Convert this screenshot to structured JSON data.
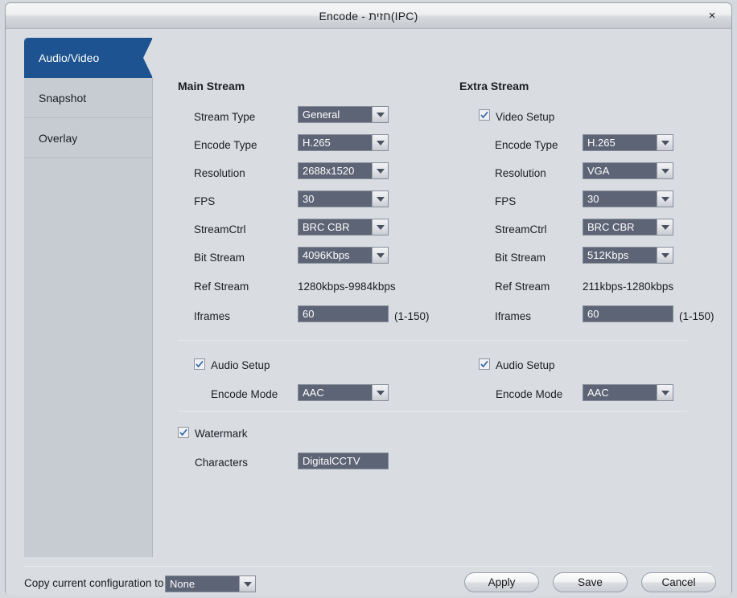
{
  "window": {
    "title": "Encode  - חזית(IPC)",
    "close_icon": "close-icon",
    "close_glyph": "×"
  },
  "sidebar": {
    "items": [
      {
        "label": "Audio/Video",
        "active": true
      },
      {
        "label": "Snapshot",
        "active": false
      },
      {
        "label": "Overlay",
        "active": false
      }
    ]
  },
  "main_stream": {
    "heading": "Main Stream",
    "fields": {
      "stream_type": {
        "label": "Stream Type",
        "value": "General"
      },
      "encode_type": {
        "label": "Encode Type",
        "value": "H.265"
      },
      "resolution": {
        "label": "Resolution",
        "value": "2688x1520"
      },
      "fps": {
        "label": "FPS",
        "value": "30"
      },
      "stream_ctrl": {
        "label": "StreamCtrl",
        "value": "BRC  CBR"
      },
      "bit_stream": {
        "label": "Bit Stream",
        "value": "4096Kbps"
      },
      "ref_stream": {
        "label": "Ref Stream",
        "value": "1280kbps-9984kbps"
      },
      "iframes": {
        "label": "Iframes",
        "value": "60",
        "hint": "(1-150)"
      }
    },
    "audio": {
      "setup_label": "Audio Setup",
      "setup_checked": true,
      "encode_mode_label": "Encode Mode",
      "encode_mode_value": "AAC"
    }
  },
  "extra_stream": {
    "heading": "Extra Stream",
    "video_setup": {
      "label": "Video Setup",
      "checked": true
    },
    "fields": {
      "encode_type": {
        "label": "Encode Type",
        "value": "H.265"
      },
      "resolution": {
        "label": "Resolution",
        "value": "VGA"
      },
      "fps": {
        "label": "FPS",
        "value": "30"
      },
      "stream_ctrl": {
        "label": "StreamCtrl",
        "value": "BRC  CBR"
      },
      "bit_stream": {
        "label": "Bit Stream",
        "value": "512Kbps"
      },
      "ref_stream": {
        "label": "Ref Stream",
        "value": "211kbps-1280kbps"
      },
      "iframes": {
        "label": "Iframes",
        "value": "60",
        "hint": "(1-150)"
      }
    },
    "audio": {
      "setup_label": "Audio Setup",
      "setup_checked": true,
      "encode_mode_label": "Encode Mode",
      "encode_mode_value": "AAC"
    }
  },
  "watermark": {
    "label": "Watermark",
    "checked": true,
    "characters_label": "Characters",
    "characters_value": "DigitalCCTV"
  },
  "footer": {
    "copy_label": "Copy current configuration to",
    "copy_value": "None",
    "apply_label": "Apply",
    "save_label": "Save",
    "cancel_label": "Cancel"
  },
  "colors": {
    "accent_tab": "#1d5390",
    "field_bg": "#5c6475",
    "window_bg": "#d9dde2",
    "sidebar_bg": "#c7ccd3"
  }
}
